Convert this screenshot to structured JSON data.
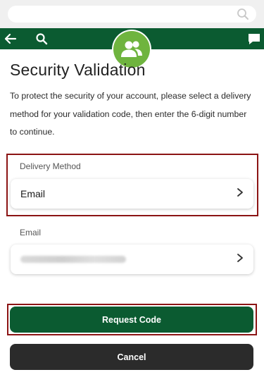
{
  "browser": {
    "search_icon": "magnifier-icon"
  },
  "header": {
    "back_icon": "arrow-left-icon",
    "search_icon": "search-icon",
    "chat_icon": "chat-icon",
    "avatar_icon": "users-icon",
    "brand_color": "#0b5b31",
    "avatar_color": "#6fb43f"
  },
  "main": {
    "title": "Security Validation",
    "intro": "To protect the security of your account, please select a delivery method for your validation code, then enter the 6-digit number to continue.",
    "delivery_method": {
      "label": "Delivery Method",
      "value": "Email"
    },
    "email": {
      "label": "Email",
      "value_redacted": true
    }
  },
  "actions": {
    "request_label": "Request Code",
    "cancel_label": "Cancel"
  },
  "colors": {
    "highlight": "#8b1414",
    "secondary_button": "#2b2b2b"
  }
}
